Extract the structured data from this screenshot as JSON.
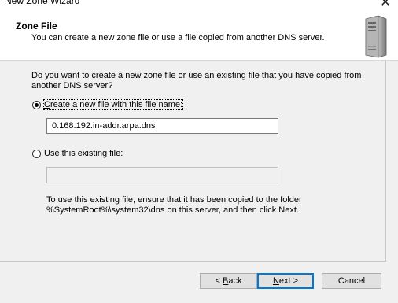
{
  "window": {
    "title": "New Zone Wizard",
    "close_glyph": "✕"
  },
  "header": {
    "title": "Zone File",
    "subtitle": "You can create a new zone file or use a file copied from another DNS server.",
    "icon": "server-icon"
  },
  "question": "Do you want to create a new zone file or use an existing file that you have copied from another DNS server?",
  "options": {
    "create_new": {
      "label_underlined": "C",
      "label_rest": "reate a new file with this file name:",
      "selected": true,
      "value": "0.168.192.in-addr.arpa.dns"
    },
    "use_existing": {
      "label_underlined": "U",
      "label_rest": "se this existing file:",
      "selected": false,
      "value": ""
    }
  },
  "help_text_line1": "To use this existing file, ensure that it has been copied to the folder",
  "help_text_line2": "%SystemRoot%\\system32\\dns on this server, and then click Next.",
  "buttons": {
    "back": {
      "prefix": "< ",
      "underlined": "B",
      "rest": "ack"
    },
    "next": {
      "underlined": "N",
      "rest": "ext >"
    },
    "cancel": "Cancel"
  },
  "colors": {
    "accent": "#0078d7",
    "body_bg": "#f0f0f0",
    "header_bg": "#ffffff"
  }
}
